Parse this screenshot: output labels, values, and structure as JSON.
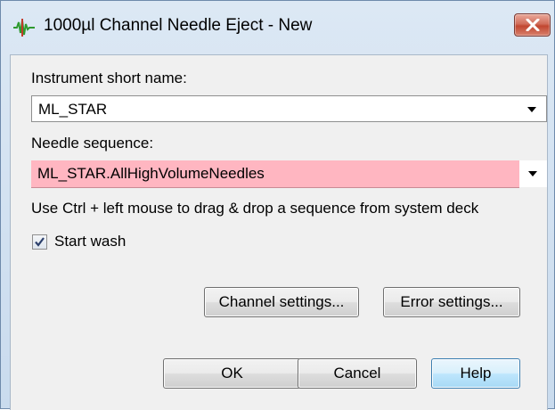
{
  "window": {
    "title": "1000µl Channel Needle Eject - New",
    "icon": "hamilton-channel-icon",
    "close_icon": "close-icon"
  },
  "instrument": {
    "label": "Instrument short name:",
    "value": "ML_STAR"
  },
  "needle": {
    "label": "Needle sequence:",
    "value": "ML_STAR.AllHighVolumeNeedles",
    "highlight_color": "#ffb6c1"
  },
  "hint": "Use Ctrl + left mouse to drag & drop a sequence from system deck",
  "start_wash": {
    "label": "Start wash",
    "checked": true
  },
  "buttons": {
    "channel_settings": "Channel settings...",
    "error_settings": "Error settings...",
    "ok": "OK",
    "cancel": "Cancel",
    "help": "Help"
  }
}
